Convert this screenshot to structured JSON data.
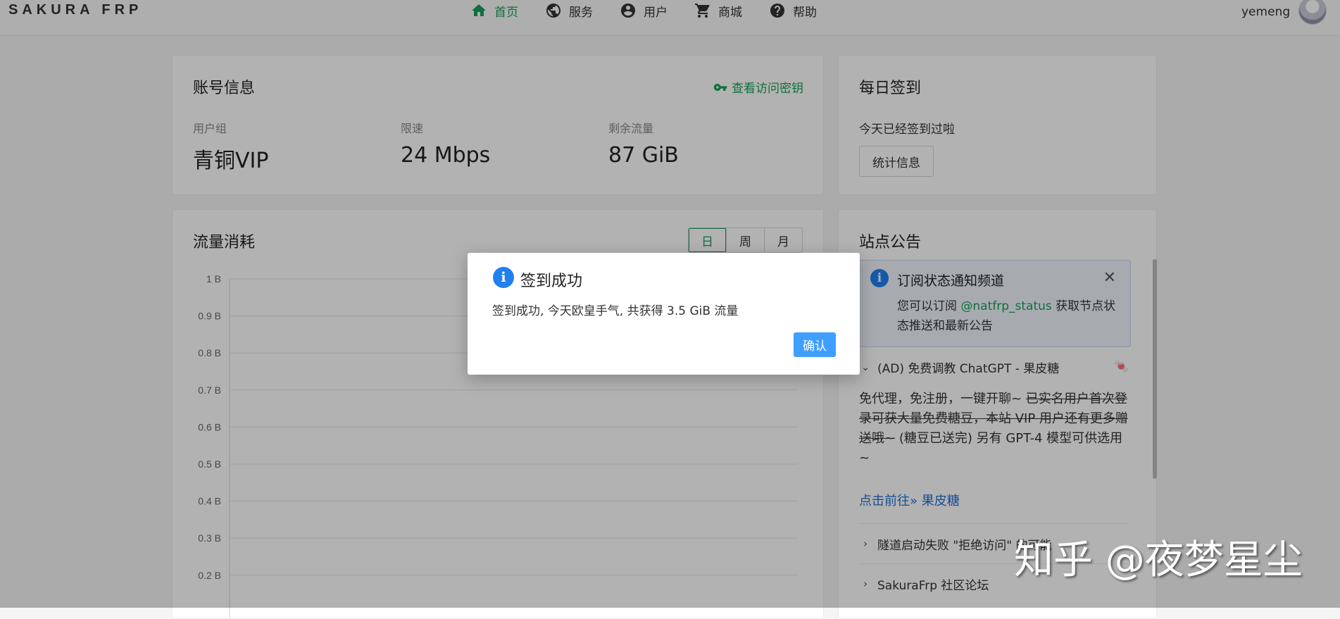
{
  "app": {
    "logo": "SAKURA FRP"
  },
  "nav": [
    {
      "label": "首页",
      "icon": "home-icon",
      "active": true
    },
    {
      "label": "服务",
      "icon": "globe-icon",
      "active": false
    },
    {
      "label": "用户",
      "icon": "account-icon",
      "active": false
    },
    {
      "label": "商城",
      "icon": "cart-icon",
      "active": false
    },
    {
      "label": "帮助",
      "icon": "help-icon",
      "active": false
    }
  ],
  "user": {
    "name": "yemeng"
  },
  "account": {
    "title": "账号信息",
    "key_link": "查看访问密钥",
    "stats": [
      {
        "label": "用户组",
        "value": "青铜VIP"
      },
      {
        "label": "限速",
        "value": "24 Mbps"
      },
      {
        "label": "剩余流量",
        "value": "87 GiB"
      }
    ]
  },
  "checkin": {
    "title": "每日签到",
    "status": "今天已经签到过啦",
    "stats_button": "统计信息"
  },
  "traffic": {
    "title": "流量消耗",
    "periods": [
      "日",
      "周",
      "月"
    ],
    "active_period": "日"
  },
  "chart_data": {
    "type": "line",
    "title": "流量消耗",
    "y_tick_labels": [
      "1 B",
      "0.9 B",
      "0.8 B",
      "0.7 B",
      "0.6 B",
      "0.5 B",
      "0.4 B",
      "0.3 B",
      "0.2 B"
    ],
    "ylim": [
      0,
      1
    ],
    "grid": true,
    "series": []
  },
  "announcements": {
    "title": "站点公告",
    "notice": {
      "title": "订阅状态通知频道",
      "body_prefix": "您可以订阅",
      "handle": "@natfrp_status",
      "body_suffix": "获取节点状态推送和最新公告"
    },
    "ad": {
      "title": "(AD) 免费调教 ChatGPT - 果皮糖",
      "text_1": "免代理，免注册，一键开聊~",
      "text_2_strike": "已实名用户首次登录可获大量免费糖豆，本站 VIP 用户还有更多赠送哦~",
      "text_3": "(糖豆已送完) 另有 GPT-4 模型可供选用~",
      "link": "点击前往» 果皮糖"
    },
    "items": [
      "隧道启动失败 \"拒绝访问\" 的可能",
      "SakuraFrp 社区论坛"
    ]
  },
  "dialog": {
    "title": "签到成功",
    "message": "签到成功, 今天欧皇手气, 共获得 3.5 GiB 流量",
    "confirm": "确认"
  },
  "watermark": "知乎 @夜梦星尘",
  "colors": {
    "brand_green": "#18a058",
    "info_blue": "#2080f0",
    "primary_button": "#409eff",
    "link_blue": "#2070d0"
  }
}
